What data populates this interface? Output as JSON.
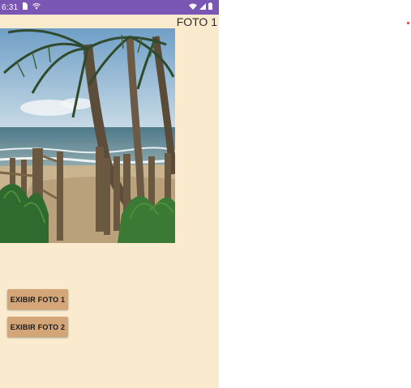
{
  "status_bar": {
    "time": "6:31",
    "icons": [
      "sim-card-icon",
      "cast-icon",
      "wifi-icon",
      "signal-icon",
      "battery-icon"
    ]
  },
  "screen": {
    "title": "FOTO 1",
    "photo_alt": "Praia com coqueiros e cerca de madeira"
  },
  "buttons": {
    "show_photo_1": "EXIBIR FOTO 1",
    "show_photo_2": "EXIBIR FOTO 2"
  },
  "colors": {
    "status_bar": "#7a57b5",
    "background": "#faebcf",
    "button": "#d4a577",
    "indicator_dot": "#e53935"
  }
}
